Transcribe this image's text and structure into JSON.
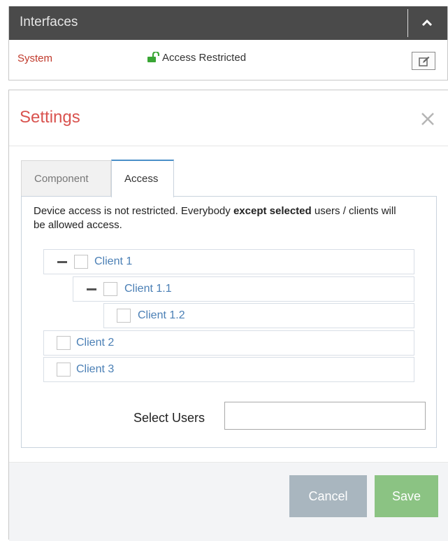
{
  "interfaces": {
    "title": "Interfaces",
    "row": {
      "name": "System",
      "access_label": "Access Restricted"
    }
  },
  "modal": {
    "title": "Settings",
    "tabs": [
      {
        "label": "Component",
        "active": false
      },
      {
        "label": "Access",
        "active": true
      }
    ],
    "description": {
      "part1": "Device access is not restricted. Everybody ",
      "bold": "except selected",
      "part2": " users / clients will be allowed access."
    },
    "tree": [
      {
        "label": "Client 1",
        "level": 0,
        "checked": false,
        "collapsible": true
      },
      {
        "label": "Client 1.1",
        "level": 1,
        "checked": false,
        "collapsible": true
      },
      {
        "label": "Client 1.2",
        "level": 2,
        "checked": false,
        "collapsible": false
      },
      {
        "label": "Client 2",
        "level": 0,
        "checked": false,
        "collapsible": false
      },
      {
        "label": "Client 3",
        "level": 0,
        "checked": false,
        "collapsible": false
      }
    ],
    "select_users": {
      "label": "Select Users",
      "value": ""
    },
    "buttons": {
      "cancel": "Cancel",
      "save": "Save"
    }
  },
  "colors": {
    "header_bg": "#4a4a4a",
    "title_red": "#d9534f",
    "link_blue": "#4a7fb5",
    "save_green": "#8bc383",
    "cancel_gray": "#a9b6bf",
    "lock_green": "#3aa635"
  },
  "icons": {
    "collapse": "chevron-up-icon",
    "lock": "unlocked-lock-icon",
    "edit": "edit-icon",
    "close": "close-icon",
    "tree_toggle": "minus-icon"
  }
}
